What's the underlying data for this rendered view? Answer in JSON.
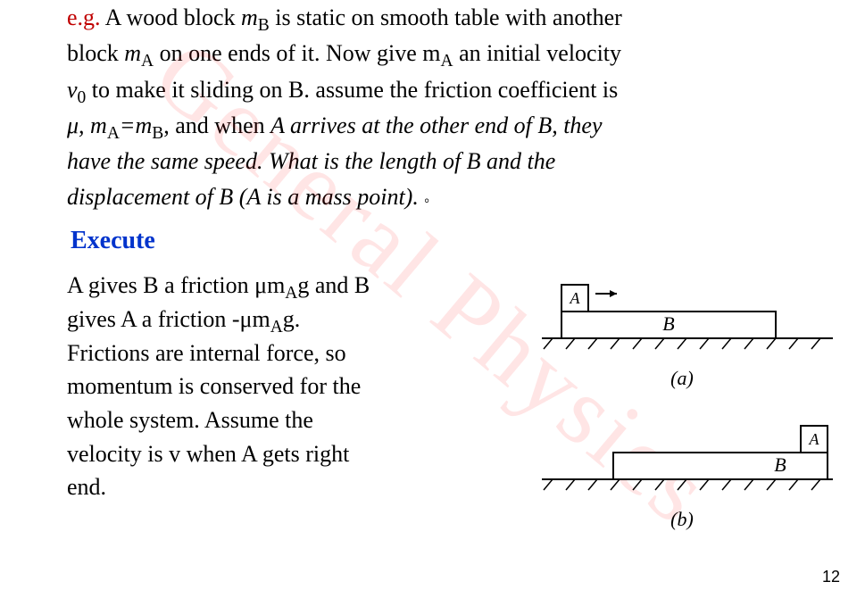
{
  "watermark": "General Physics",
  "problem": {
    "eg_prefix": "e.g.",
    "line1_a": " A wood block ",
    "mB": "m",
    "mB_sub": "B",
    "line1_b": " is static on smooth table with another",
    "line2_a": "block ",
    "mA": "m",
    "mA_sub": "A",
    "line2_b": " on one ends of it. Now give m",
    "line2_c": " an initial velocity",
    "line3_a": "v",
    "v0_sub": "0",
    "line3_b": " to make it sliding on B. assume the friction coefficient is",
    "line4_a": "μ,   m",
    "line4_b": "=m",
    "line4_c": ", and when ",
    "line4_italic": "A arrives at the other end of B, they",
    "line5_italic": "have the same speed. What is the length of B and the",
    "line6_italic": "displacement of B (A is a mass point). ",
    "trailing_dot": "。"
  },
  "execute_title": "Execute",
  "solution": {
    "s1_a": "A gives B a friction μm",
    "s1_sub": "A",
    "s1_b": "g and B",
    "s2_a": "gives A a friction -μm",
    "s2_sub": "A",
    "s2_b": "g.",
    "s3": "Frictions are internal force, so",
    "s4": "momentum is conserved for the",
    "s5": "whole system. Assume the",
    "s6": "velocity is v when A gets right",
    "s7": "end."
  },
  "figure": {
    "label_a": "(a)",
    "label_b": "(b)",
    "block_A": "A",
    "block_B": "B"
  },
  "page_number": "12"
}
